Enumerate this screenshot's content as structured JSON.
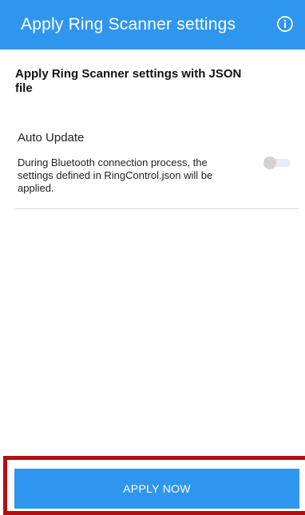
{
  "header": {
    "title": "Apply Ring Scanner settings",
    "info_icon": "info-circle-icon",
    "background_color": "#2f96ef"
  },
  "section": {
    "title": "Apply Ring Scanner settings with JSON file"
  },
  "settings": [
    {
      "label": "Auto Update",
      "description": "During Bluetooth connection process, the settings defined in RingControl.json will be applied.",
      "toggle_on": false
    }
  ],
  "footer": {
    "apply_label": "APPLY NOW",
    "highlight_color": "#b30f12"
  }
}
